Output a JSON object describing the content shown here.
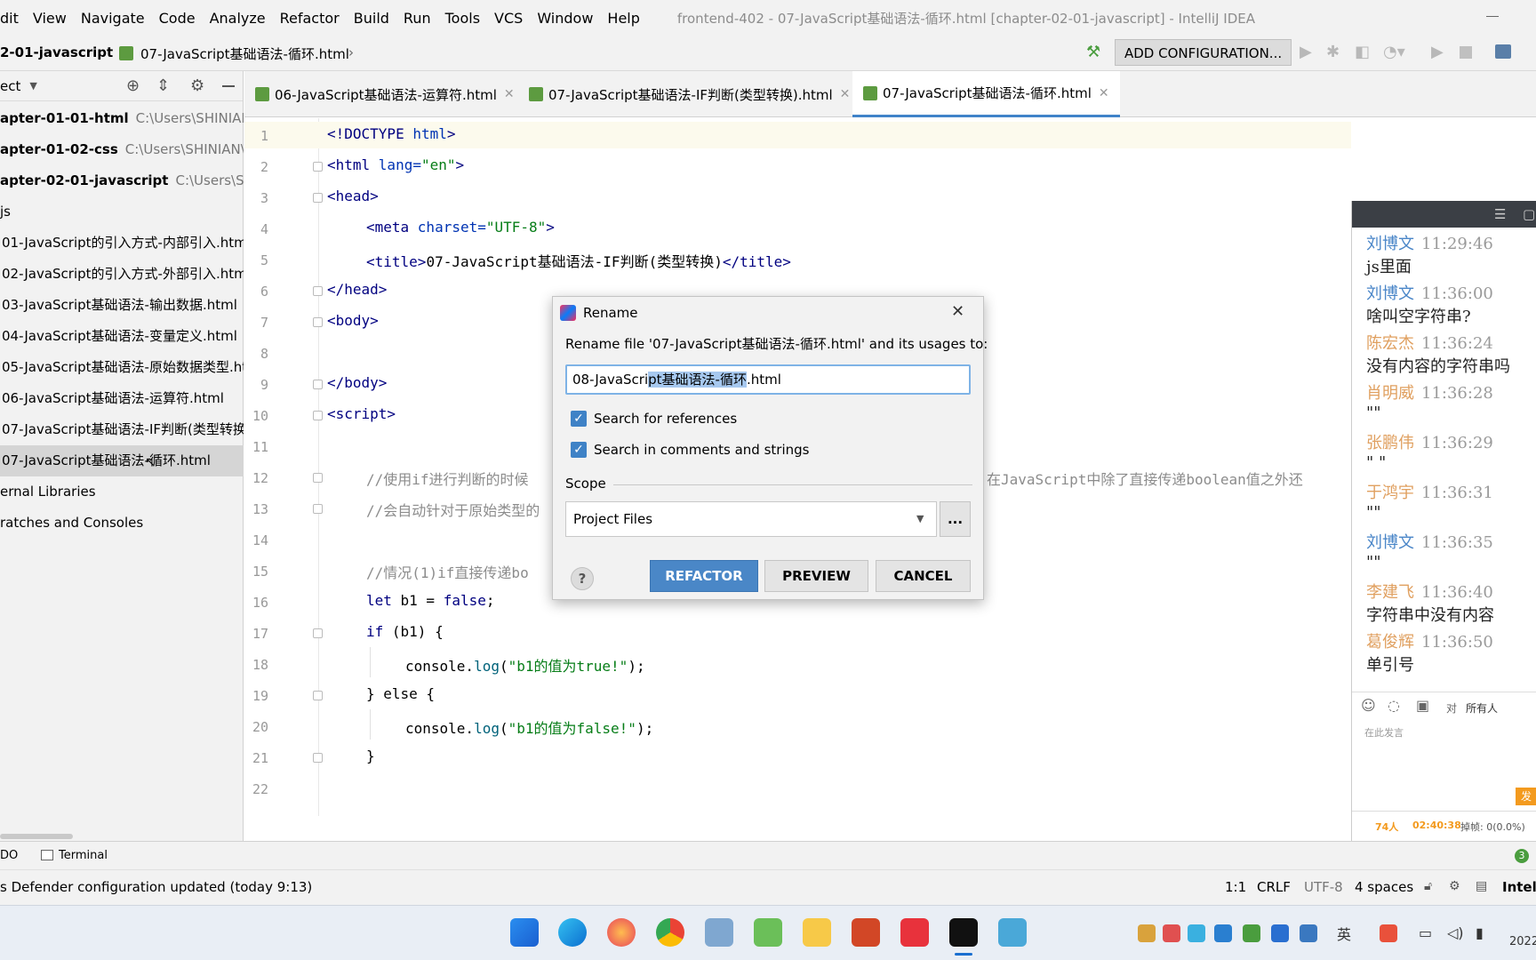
{
  "menu": [
    "dit",
    "View",
    "Navigate",
    "Code",
    "Analyze",
    "Refactor",
    "Build",
    "Run",
    "Tools",
    "VCS",
    "Window",
    "Help"
  ],
  "window_title": "frontend-402 - 07-JavaScript基础语法-循环.html [chapter-02-01-javascript] - IntelliJ IDEA",
  "breadcrumb": {
    "project": "2-01-javascript",
    "file": "07-JavaScript基础语法-循环.html"
  },
  "run_config_label": "ADD CONFIGURATION...",
  "project_panel": {
    "title": "ect",
    "items": [
      {
        "label": "apter-01-01-html",
        "path": "C:\\Users\\SHINIAN\\"
      },
      {
        "label": "apter-01-02-css",
        "path": "C:\\Users\\SHINIAN\\Id"
      },
      {
        "label": "apter-02-01-javascript",
        "path": "C:\\Users\\SHIN"
      },
      {
        "label": "js",
        "path": ""
      },
      {
        "label": "01-JavaScript的引入方式-内部引入.htm",
        "path": ""
      },
      {
        "label": "02-JavaScript的引入方式-外部引入.htm",
        "path": ""
      },
      {
        "label": "03-JavaScript基础语法-输出数据.html",
        "path": ""
      },
      {
        "label": "04-JavaScript基础语法-变量定义.html",
        "path": ""
      },
      {
        "label": "05-JavaScript基础语法-原始数据类型.ht",
        "path": ""
      },
      {
        "label": "06-JavaScript基础语法-运算符.html",
        "path": ""
      },
      {
        "label": "07-JavaScript基础语法-IF判断(类型转换)",
        "path": ""
      },
      {
        "label": "07-JavaScript基础语法-循环.html",
        "path": ""
      },
      {
        "label": "ernal Libraries",
        "path": ""
      },
      {
        "label": "ratches and Consoles",
        "path": ""
      }
    ]
  },
  "tabs": [
    {
      "label": "06-JavaScript基础语法-运算符.html"
    },
    {
      "label": "07-JavaScript基础语法-IF判断(类型转换).html"
    },
    {
      "label": "07-JavaScript基础语法-循环.html"
    }
  ],
  "line_numbers": [
    "1",
    "2",
    "3",
    "4",
    "5",
    "6",
    "7",
    "8",
    "9",
    "10",
    "11",
    "12",
    "13",
    "14",
    "15",
    "16",
    "17",
    "18",
    "19",
    "20",
    "21",
    "22"
  ],
  "code": {
    "l1a": "<!DOCTYPE ",
    "l1b": "html",
    ">": ">",
    "l2a": "<html ",
    "l2b": "lang=",
    "l2c": "\"en\"",
    "l2d": ">",
    "l3": "<head>",
    "l4a": "<meta ",
    "l4b": "charset=",
    "l4c": "\"UTF-8\"",
    "l4d": ">",
    "l5a": "<title>",
    "l5b": "07-JavaScript基础语法-IF判断(类型转换)",
    "l5c": "</title>",
    "l6": "</head>",
    "l7": "<body>",
    "l9": "</body>",
    "l10": "<script>",
    "l12a": "//使用if进行判断的时候",
    "l12b": "在JavaScript中除了直接传递boolean值之外还",
    "l13": "//会自动针对于原始类型的",
    "l15": "//情况(1)if直接传递bo",
    "l16a": "let ",
    "l16b": "b1 = ",
    "l16c": "false",
    ";": ";",
    "l17a": "if ",
    "l17b": "(b1) {",
    "l18a": "console.",
    "l18b": "log",
    "l18c": "(",
    "l18d": "\"b1的值为true!\"",
    "l18e": ");",
    "l19": "} else {",
    "l20a": "console.",
    "l20b": "log",
    "l20c": "(",
    "l20d": "\"b1的值为false!\"",
    "l20e": ");",
    "l21": "}"
  },
  "dialog": {
    "title": "Rename",
    "prompt": "Rename file '07-JavaScript基础语法-循环.html' and its usages to:",
    "value_pre": "08-JavaScri",
    "value_sel": "pt基础语法-循环",
    "value_post": ".html",
    "check_refs": "Search for references",
    "check_comments": "Search in comments and strings",
    "scope_label": "Scope",
    "scope_value": "Project Files",
    "more": "...",
    "help": "?",
    "refactor": "REFACTOR",
    "preview": "PREVIEW",
    "cancel": "CANCEL"
  },
  "chat": {
    "messages": [
      {
        "name": "刘博文",
        "time": "11:29:46",
        "text": "js里面",
        "color": "#4a86c8"
      },
      {
        "name": "刘博文",
        "time": "11:36:00",
        "text": "啥叫空字符串?",
        "color": "#4a86c8"
      },
      {
        "name": "陈宏杰",
        "time": "11:36:24",
        "text": "没有内容的字符串吗",
        "color": "#e0a060"
      },
      {
        "name": "肖明威",
        "time": "11:36:28",
        "text": "\"\"",
        "color": "#e0a060"
      },
      {
        "name": "张鹏伟",
        "time": "11:36:29",
        "text": "\"  \"",
        "color": "#e0a060"
      },
      {
        "name": "于鸿宇",
        "time": "11:36:31",
        "text": "\"\"",
        "color": "#e0a060"
      },
      {
        "name": "刘博文",
        "time": "11:36:35",
        "text": "\"\"",
        "color": "#4a86c8"
      },
      {
        "name": "李建飞",
        "time": "11:36:40",
        "text": "字符串中没有内容",
        "color": "#e0a060"
      },
      {
        "name": "葛俊辉",
        "time": "11:36:50",
        "text": "单引号",
        "color": "#e0a060"
      }
    ],
    "to_label": "对",
    "audience": "所有人",
    "placeholder": "在此发言",
    "count": "74人",
    "timer": "02:40:38",
    "drops": "掉帧: 0(0.0%)",
    "send": "发"
  },
  "toolwindows": {
    "todo": "DO",
    "terminal": "Terminal"
  },
  "status": {
    "message": "s Defender configuration updated (today 9:13)",
    "pos": "1:1",
    "eol": "CRLF",
    "enc": "UTF-8",
    "indent": "4 spaces",
    "brand": "Intelli"
  },
  "taskbar": {
    "ime": "英",
    "clock": "2022"
  }
}
